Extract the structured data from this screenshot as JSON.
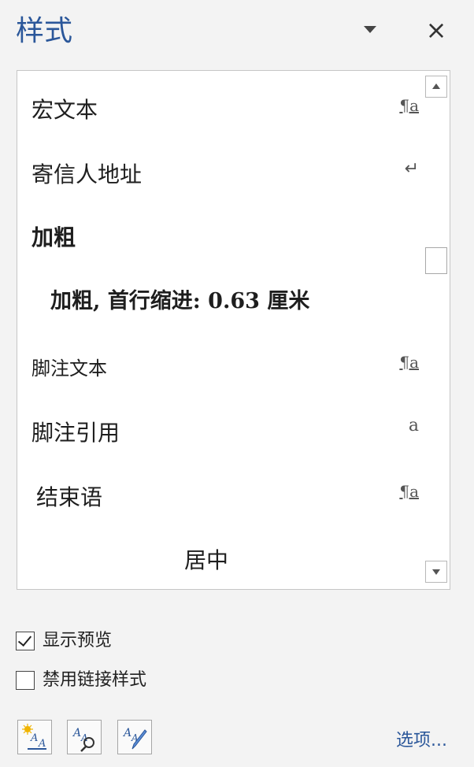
{
  "pane": {
    "title": "样式",
    "dropdown_icon": "chevron-down-icon",
    "close_label": "×"
  },
  "styles": [
    {
      "label": "宏文本",
      "marker": "¶a",
      "marker_type": "linked-paragraph-character"
    },
    {
      "label": "寄信人地址",
      "marker": "↵",
      "marker_type": "paragraph"
    },
    {
      "label": "加粗",
      "marker": "",
      "marker_type": "none"
    },
    {
      "label": "加粗, 首行缩进:  0.63 厘米",
      "marker": "",
      "marker_type": "none"
    },
    {
      "label": "脚注文本",
      "marker": "¶a",
      "marker_type": "linked-paragraph-character"
    },
    {
      "label": "脚注引用",
      "marker": "a",
      "marker_type": "character"
    },
    {
      "label": "结束语",
      "marker": "¶a",
      "marker_type": "linked-paragraph-character"
    },
    {
      "label": "居中",
      "marker": "",
      "marker_type": "none"
    }
  ],
  "options": {
    "show_preview": {
      "label": "显示预览",
      "checked": true
    },
    "disable_linked": {
      "label": "禁用链接样式",
      "checked": false
    }
  },
  "toolbar": {
    "new_style_icon": "new-style-icon",
    "style_inspector_icon": "style-inspector-icon",
    "manage_styles_icon": "manage-styles-icon",
    "options_link": "选项..."
  },
  "colors": {
    "accent": "#2b579a",
    "panel_bg": "#f3f3f3",
    "list_bg": "#ffffff"
  }
}
